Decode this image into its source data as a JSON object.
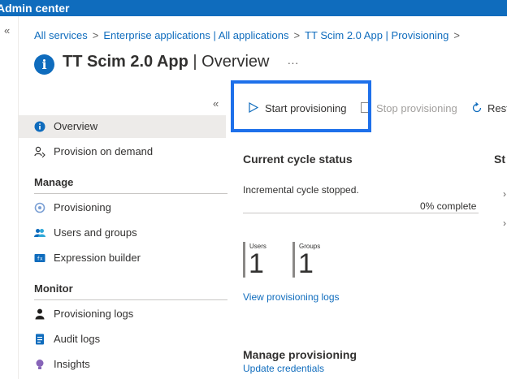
{
  "topbar": {
    "title": "Admin center"
  },
  "breadcrumb": {
    "items": [
      "All services",
      "Enterprise applications | All applications",
      "TT Scim 2.0 App | Provisioning"
    ],
    "separator": ">"
  },
  "header": {
    "title_bold": "TT Scim 2.0 App",
    "title_light": " | Overview",
    "more": "···"
  },
  "sidebar": {
    "collapse": "«",
    "items": {
      "overview": "Overview",
      "provision_on_demand": "Provision on demand",
      "manage_head": "Manage",
      "provisioning": "Provisioning",
      "users_and_groups": "Users and groups",
      "expression_builder": "Expression builder",
      "monitor_head": "Monitor",
      "provisioning_logs": "Provisioning logs",
      "audit_logs": "Audit logs",
      "insights": "Insights"
    }
  },
  "toolbar": {
    "start": "Start provisioning",
    "stop": "Stop provisioning",
    "restart": "Rest"
  },
  "cycle": {
    "title": "Current cycle status",
    "status": "Incremental cycle stopped.",
    "progress_text": "0% complete",
    "progress": 0,
    "right_title": "St"
  },
  "counts": {
    "users_label": "Users",
    "users_value": "1",
    "groups_label": "Groups",
    "groups_value": "1"
  },
  "links": {
    "view_logs": "View provisioning logs",
    "update_credentials": "Update credentials"
  },
  "manage_section": {
    "title": "Manage provisioning"
  },
  "colors": {
    "accent": "#0f6cbd",
    "highlight": "#1e70ea"
  }
}
